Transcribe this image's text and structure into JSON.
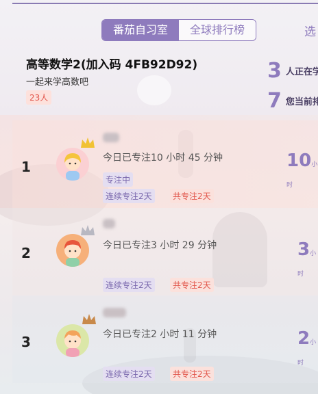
{
  "tabs": {
    "active_label": "番茄自习室",
    "inactive_label": "全球排行榜",
    "next_label": "选"
  },
  "room": {
    "title": "高等数学2(加入码 4FB92D92)",
    "subtitle": "一起来学高数吧",
    "member_count": "23人"
  },
  "stats": [
    {
      "value": "3",
      "label": "人正在学"
    },
    {
      "value": "7",
      "label": "您当前排"
    }
  ],
  "ranking": [
    {
      "rank": "1",
      "focus_today": "今日已专注10 小时 45 分钟",
      "status": "专注中",
      "streak": "连续专注2天",
      "total": "共专注2天",
      "right_value": "10",
      "right_unit": "小时",
      "crown_color": "#f1c232",
      "avatar_bg": "#fbd0d3"
    },
    {
      "rank": "2",
      "focus_today": "今日已专注3 小时 29 分钟",
      "streak": "连续专注2天",
      "total": "共专注2天",
      "right_value": "3",
      "right_unit": "小时",
      "crown_color": "#b8b8c2",
      "avatar_bg": "#f6b07a"
    },
    {
      "rank": "3",
      "focus_today": "今日已专注2 小时 11 分钟",
      "streak": "连续专注2天",
      "total": "共专注2天",
      "right_value": "2",
      "right_unit": "小时",
      "crown_color": "#c8894a",
      "avatar_bg": "#dbe7a8"
    }
  ],
  "colors": {
    "accent": "#8e7bbd",
    "red": "#e2574c"
  }
}
